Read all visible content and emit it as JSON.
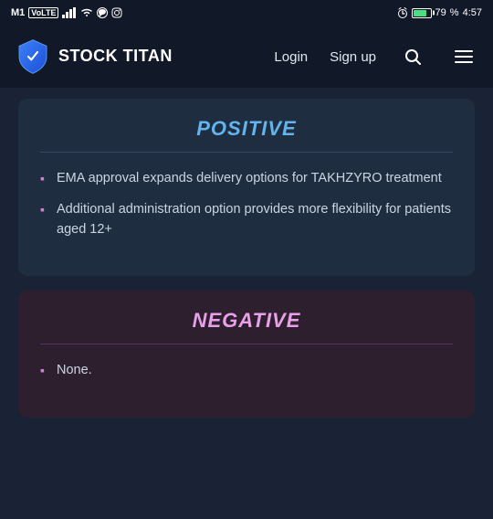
{
  "statusBar": {
    "carrier": "M1",
    "volte": "VoLTE",
    "time": "4:57",
    "battery": 79
  },
  "navbar": {
    "logoText": "STOCK TITAN",
    "loginLabel": "Login",
    "signupLabel": "Sign up"
  },
  "positiveCard": {
    "title": "Positive",
    "items": [
      "EMA approval expands delivery options for TAKHZYRO treatment",
      "Additional administration option provides more flexibility for patients aged 12+"
    ]
  },
  "negativeCard": {
    "title": "Negative",
    "items": [
      "None."
    ]
  }
}
